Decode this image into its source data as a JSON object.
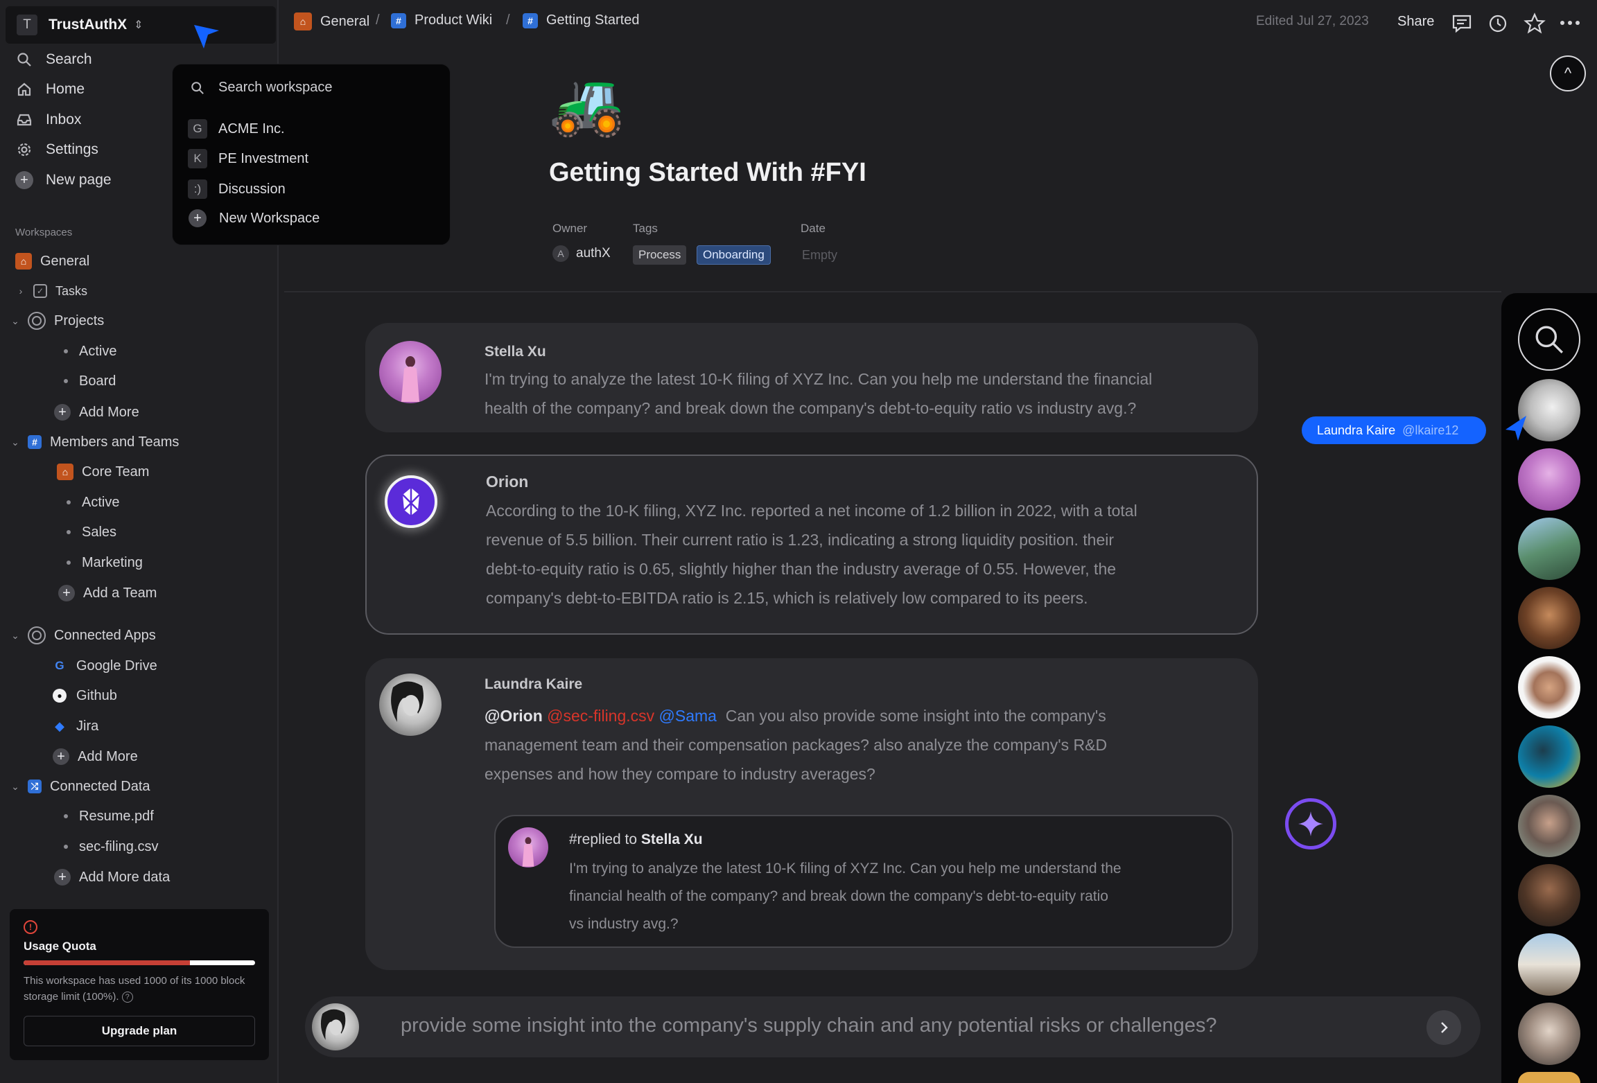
{
  "workspace": {
    "badge": "T",
    "name": "TrustAuthX"
  },
  "nav": {
    "search": "Search",
    "home": "Home",
    "inbox": "Inbox",
    "settings": "Settings",
    "new_page": "New page"
  },
  "sidebar": {
    "workspaces_label": "Workspaces",
    "general": "General",
    "tasks": "Tasks",
    "projects": "Projects",
    "projects_items": [
      "Active",
      "Board"
    ],
    "projects_add": "Add More",
    "members": "Members and Teams",
    "core_team": "Core Team",
    "members_items": [
      "Active",
      "Sales",
      "Marketing"
    ],
    "members_add": "Add a Team",
    "connected_apps": "Connected Apps",
    "apps": [
      "Google Drive",
      "Github",
      "Jira"
    ],
    "apps_add": "Add More",
    "connected_data": "Connected Data",
    "data_items": [
      "Resume.pdf",
      "sec-filing.csv"
    ],
    "data_add": "Add More data"
  },
  "quota": {
    "title": "Usage Quota",
    "used_fraction": 0.72,
    "description": "This workspace has used 1000 of its 1000 block storage limit (100%).",
    "button": "Upgrade plan"
  },
  "dropdown": {
    "search_placeholder": "Search workspace",
    "items": [
      {
        "badge": "G",
        "label": "ACME Inc."
      },
      {
        "badge": "K",
        "label": "PE Investment"
      },
      {
        "badge": ":)",
        "label": "Discussion"
      }
    ],
    "new_workspace": "New Workspace"
  },
  "breadcrumb": {
    "general": "General",
    "product_wiki": "Product Wiki",
    "getting_started": "Getting Started",
    "sep": "/"
  },
  "topbar": {
    "edited": "Edited Jul 27, 2023",
    "share": "Share"
  },
  "page": {
    "emoji": "🚜",
    "title": "Getting Started With #FYI",
    "owner_label": "Owner",
    "owner_initial": "A",
    "owner": "authX",
    "tags_label": "Tags",
    "tags": [
      "Process",
      "Onboarding"
    ],
    "date_label": "Date",
    "date_value": "Empty"
  },
  "messages": [
    {
      "author": "Stella Xu",
      "lines": [
        "I'm trying to analyze the latest 10-K filing of XYZ Inc. Can you help me understand the financial",
        "health of the company? and break down the company's debt-to-equity ratio vs industry avg.?"
      ]
    },
    {
      "author": "Orion",
      "lines": [
        "According to the 10-K filing, XYZ Inc. reported a net income of 1.2 billion in 2022, with a total",
        "revenue of 5.5 billion. Their current ratio is 1.23, indicating a strong liquidity position. their",
        "debt-to-equity ratio is 0.65, slightly higher than the industry average of 0.55. However, the",
        "company's debt-to-EBITDA ratio is 2.15, which is relatively low compared to its peers."
      ]
    },
    {
      "author": "Laundra Kaire",
      "mention_orion": "@Orion",
      "mention_file": "@sec-filing.csv",
      "mention_sama": "@Sama",
      "lines": [
        "Can you also provide some insight into the company's",
        "management team and their compensation packages? also analyze the company's R&D",
        "expenses and how they compare to industry averages?"
      ],
      "reply": {
        "prefix": "#replied to",
        "to": "Stella Xu",
        "lines": [
          "I'm trying to analyze the latest 10-K filing of XYZ Inc. Can you help me understand the",
          "financial health of the company? and break down the company's debt-to-equity ratio",
          "vs industry avg.?"
        ]
      }
    }
  ],
  "composer": {
    "text": "provide some insight into the company's supply chain and any potential risks or challenges?"
  },
  "cursor_tag": {
    "name": "Laundra Kaire",
    "handle": "@lkaire12"
  },
  "colors": {
    "accent_blue": "#1463ff",
    "mention_red": "#d8352a",
    "mention_blue": "#2f7bff",
    "purple": "#7b4cf0"
  }
}
